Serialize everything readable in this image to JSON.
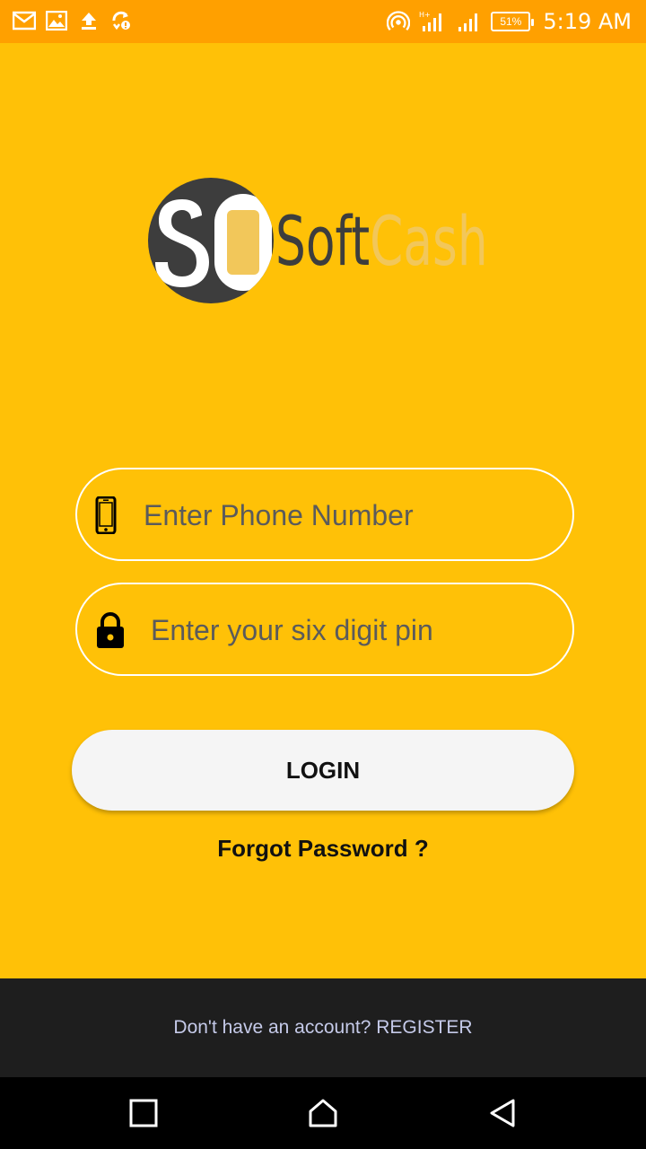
{
  "status_bar": {
    "battery": "51%",
    "time": "5:19 AM",
    "left_icons": [
      "gmail-icon",
      "image-icon",
      "upload-icon",
      "sync-icon"
    ],
    "right_icons": [
      "hotspot-icon",
      "signal-icon",
      "signal-icon-2",
      "battery-icon"
    ]
  },
  "logo": {
    "mark": "SO",
    "word_soft": "Soft",
    "word_cash": "Cash"
  },
  "form": {
    "phone_placeholder": "Enter Phone Number",
    "pin_placeholder": "Enter your six digit pin",
    "login_label": "LOGIN",
    "forgot_label": "Forgot Password ?"
  },
  "footer": {
    "register_text": "Don't have an account? REGISTER"
  },
  "colors": {
    "background": "#FFC107",
    "status_bar": "#FFA000",
    "footer": "#1e1e1e",
    "link": "#C5CAE9",
    "logo_dark": "#3d3d3d",
    "logo_accent": "#F2C75A"
  }
}
